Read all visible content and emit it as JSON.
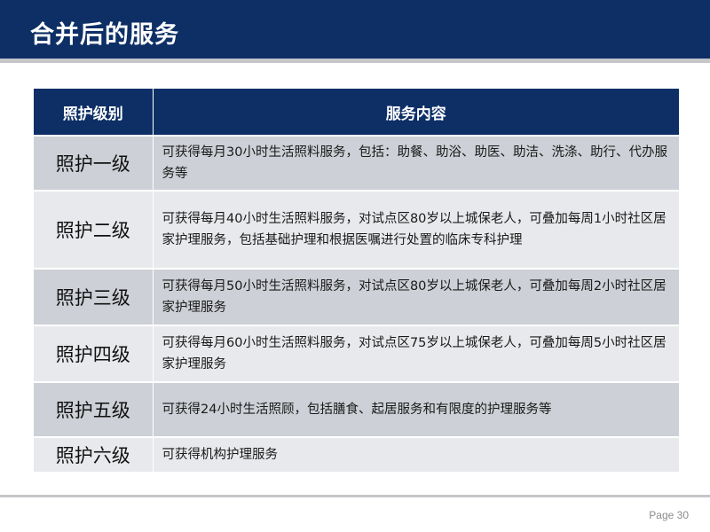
{
  "header": {
    "title": "合并后的服务"
  },
  "table": {
    "columns": [
      "照护级别",
      "服务内容"
    ],
    "rows": [
      {
        "level": "照护一级",
        "content": "可获得每月30小时生活照料服务，包括：助餐、助浴、助医、助洁、洗涤、助行、代办服务等"
      },
      {
        "level": "照护二级",
        "content": "可获得每月40小时生活照料服务，对试点区80岁以上城保老人，可叠加每周1小时社区居家护理服务，包括基础护理和根据医嘱进行处置的临床专科护理"
      },
      {
        "level": "照护三级",
        "content": "可获得每月50小时生活照料服务，对试点区80岁以上城保老人，可叠加每周2小时社区居家护理服务"
      },
      {
        "level": "照护四级",
        "content": "可获得每月60小时生活照料服务，对试点区75岁以上城保老人，可叠加每周5小时社区居家护理服务"
      },
      {
        "level": "照护五级",
        "content": "可获得24小时生活照顾，包括膳食、起居服务和有限度的护理服务等"
      },
      {
        "level": "照护六级",
        "content": "可获得机构护理服务"
      }
    ]
  },
  "footer": {
    "page_label": "Page 30"
  },
  "colors": {
    "header_bg": "#0d2f66",
    "row_odd_bg": "#cdd0d6",
    "row_even_bg": "#e8e9ec",
    "divider": "#c4c6ca"
  }
}
